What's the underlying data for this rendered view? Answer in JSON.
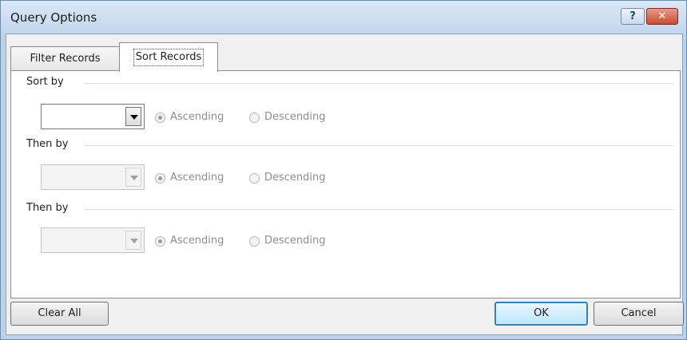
{
  "window": {
    "title": "Query Options",
    "help_label": "?",
    "close_label": "✕"
  },
  "tabs": [
    {
      "label": "Filter Records",
      "selected": false
    },
    {
      "label": "Sort Records",
      "selected": true
    }
  ],
  "sort_groups": [
    {
      "label": "Sort by",
      "field_value": "",
      "enabled": true,
      "ascending_label": "Ascending",
      "descending_label": "Descending",
      "order": "Ascending"
    },
    {
      "label": "Then by",
      "field_value": "",
      "enabled": false,
      "ascending_label": "Ascending",
      "descending_label": "Descending",
      "order": "Ascending"
    },
    {
      "label": "Then by",
      "field_value": "",
      "enabled": false,
      "ascending_label": "Ascending",
      "descending_label": "Descending",
      "order": "Ascending"
    }
  ],
  "buttons": {
    "clear_all": "Clear All",
    "ok": "OK",
    "cancel": "Cancel"
  }
}
